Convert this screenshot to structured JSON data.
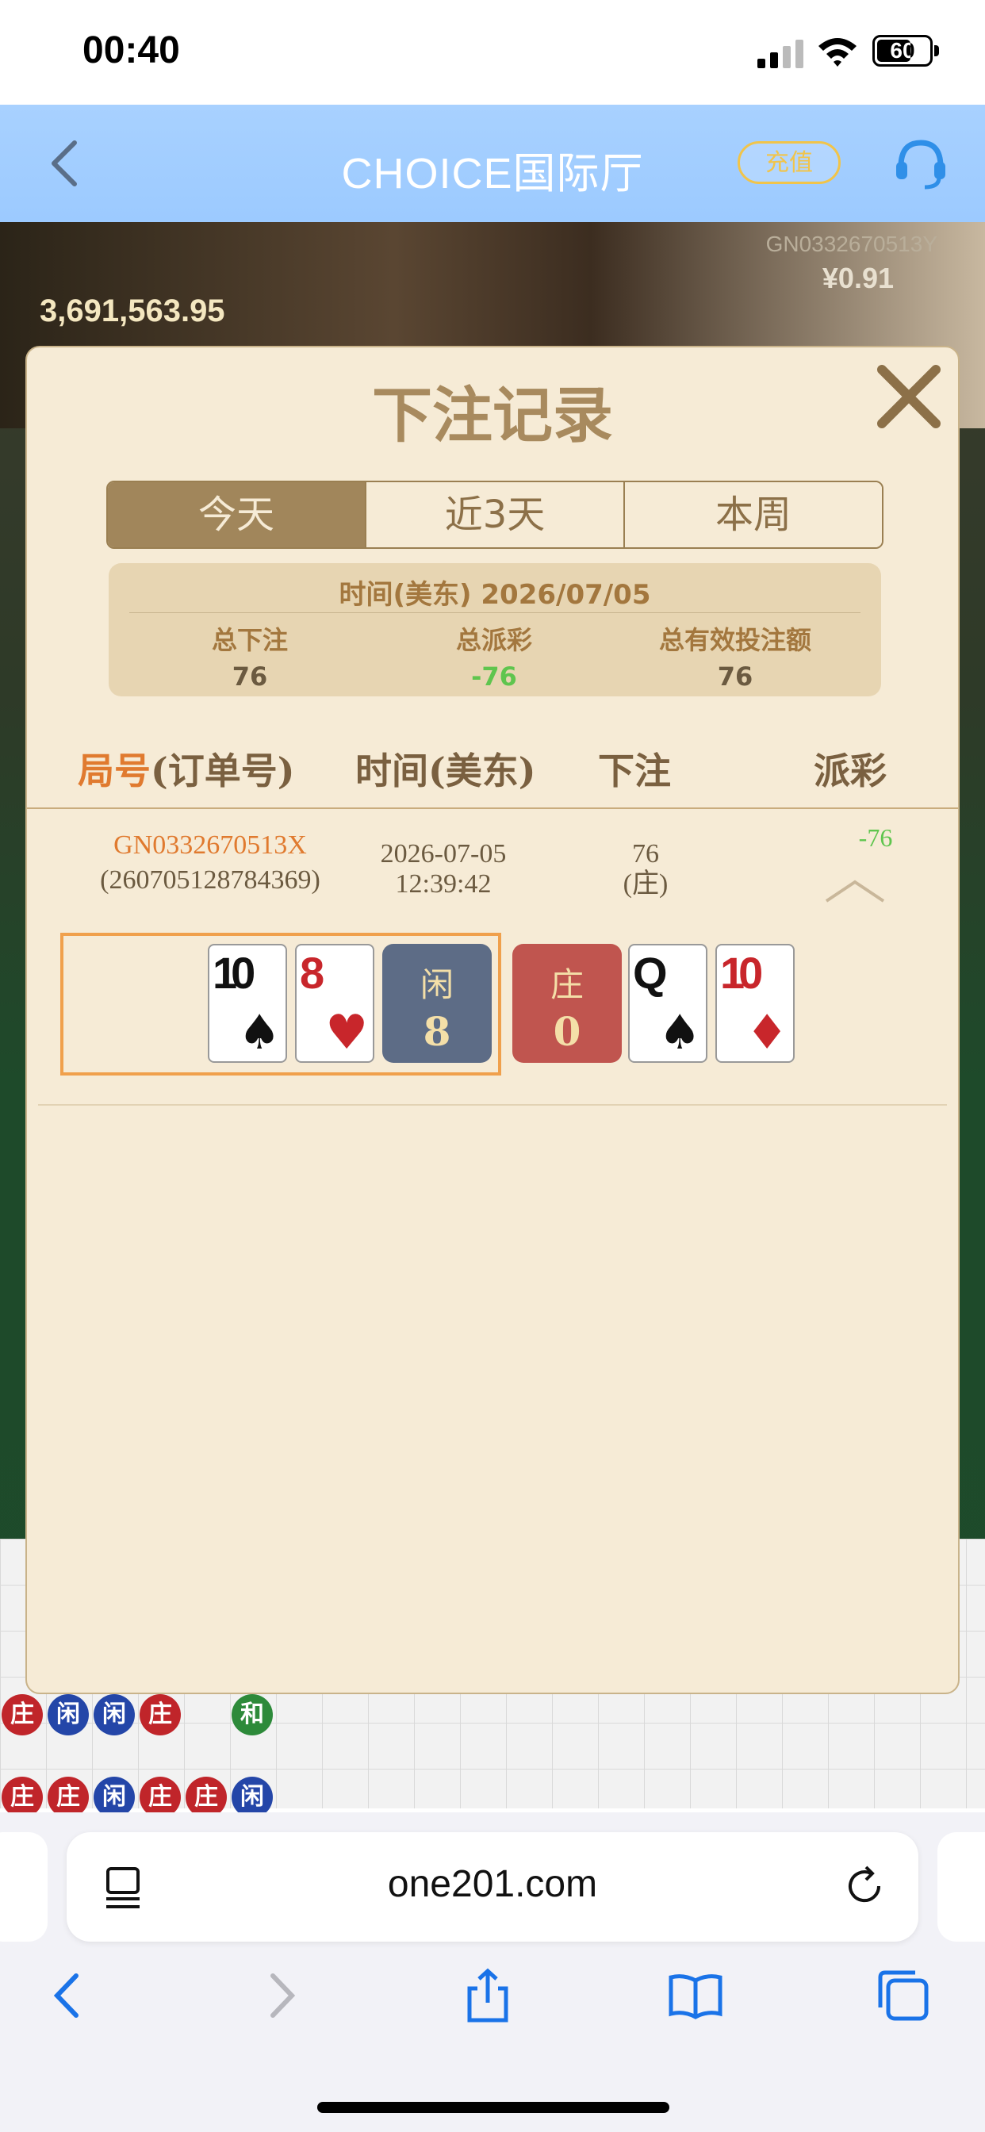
{
  "status": {
    "time": "00:40",
    "battery": "60"
  },
  "appbar": {
    "title": "CHOICE国际厅",
    "recharge": "充值"
  },
  "background": {
    "jackpot": "3,691,563.95",
    "table_id": "GN0332670513Y",
    "balance": "¥0.91"
  },
  "dialog": {
    "title": "下注记录",
    "tabs": [
      "今天",
      "近3天",
      "本周"
    ],
    "active_tab": 0,
    "summary": {
      "header": "时间(美东) 2026/07/05",
      "total_bet_label": "总下注",
      "total_bet": "76",
      "total_payout_label": "总派彩",
      "total_payout": "-76",
      "total_valid_label": "总有效投注额",
      "total_valid": "76"
    },
    "columns": {
      "round": "局号",
      "order": "(订单号)",
      "time": "时间(美东)",
      "bet": "下注",
      "payout": "派彩"
    },
    "rows": [
      {
        "round_id": "GN0332670513X",
        "order_id": "(260705128784369)",
        "date": "2026-07-05",
        "time": "12:39:42",
        "bet_amount": "76",
        "bet_side": "(庄)",
        "payout": "-76",
        "player_cards": [
          {
            "rank": "10",
            "suit": "♠",
            "color": "black"
          },
          {
            "rank": "8",
            "suit": "♥",
            "color": "red"
          }
        ],
        "player_label": "闲",
        "player_score": "8",
        "banker_label": "庄",
        "banker_score": "0",
        "banker_cards": [
          {
            "rank": "Q",
            "suit": "♠",
            "color": "black"
          },
          {
            "rank": "10",
            "suit": "♦",
            "color": "red"
          }
        ]
      }
    ]
  },
  "browser": {
    "url": "one201.com"
  }
}
